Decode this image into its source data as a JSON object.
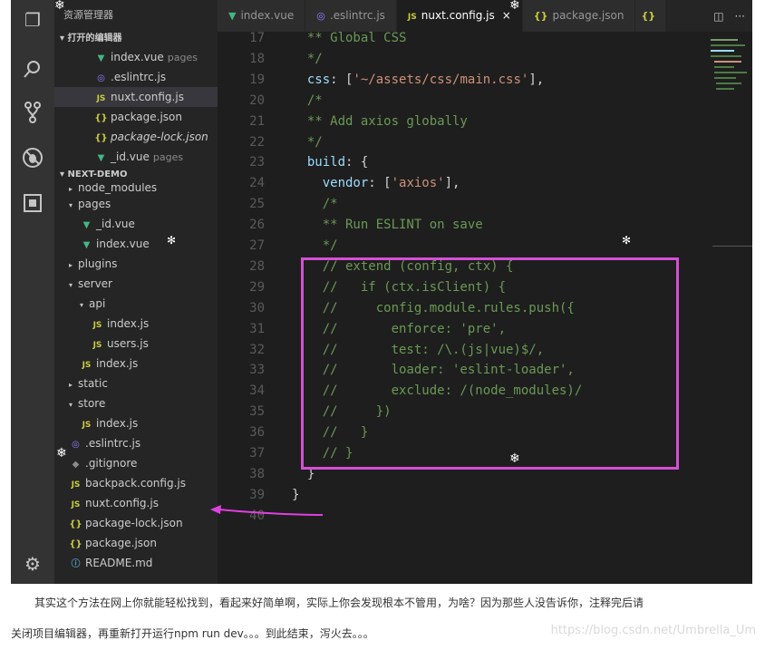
{
  "sidebar": {
    "title": "资源管理器",
    "open_editors_header": "打开的编辑器",
    "open_editors": [
      {
        "name": "index.vue",
        "hint": "pages",
        "icon": "vue-icon"
      },
      {
        "name": ".eslintrc.js",
        "hint": "",
        "icon": "eslint-icon"
      },
      {
        "name": "nuxt.config.js",
        "hint": "",
        "icon": "js-icon"
      },
      {
        "name": "package.json",
        "hint": "",
        "icon": "json-icon"
      },
      {
        "name": "package-lock.json",
        "hint": "",
        "icon": "json-icon"
      },
      {
        "name": "_id.vue",
        "hint": "pages",
        "icon": "vue-icon"
      }
    ],
    "project_header": "NEXT-DEMO",
    "tree": [
      {
        "name": "node_modules"
      },
      {
        "name": "pages"
      },
      {
        "name": "_id.vue"
      },
      {
        "name": "index.vue"
      },
      {
        "name": "plugins"
      },
      {
        "name": "server"
      },
      {
        "name": "api"
      },
      {
        "name": "index.js"
      },
      {
        "name": "users.js"
      },
      {
        "name": "index.js"
      },
      {
        "name": "static"
      },
      {
        "name": "store"
      },
      {
        "name": "index.js"
      },
      {
        "name": ".eslintrc.js"
      },
      {
        "name": ".gitignore"
      },
      {
        "name": "backpack.config.js"
      },
      {
        "name": "nuxt.config.js"
      },
      {
        "name": "package-lock.json"
      },
      {
        "name": "package.json"
      },
      {
        "name": "README.md"
      }
    ]
  },
  "tabs": [
    {
      "label": "index.vue",
      "icon": "vue-icon"
    },
    {
      "label": ".eslintrc.js",
      "icon": "eslint-icon"
    },
    {
      "label": "nuxt.config.js",
      "icon": "js-icon",
      "active": true
    },
    {
      "label": "package.json",
      "icon": "json-icon"
    },
    {
      "label": "{} ",
      "icon": "json-icon"
    }
  ],
  "tab_icons": {
    "vue": "V",
    "js": "JS",
    "json": "{}",
    "eslint": "◎",
    "close": "×",
    "split": "◫",
    "more": "···"
  },
  "editor": {
    "lines": [
      {
        "n": "17",
        "text": "  ** Global CSS"
      },
      {
        "n": "18",
        "text": "  */"
      },
      {
        "n": "19",
        "key": "  css",
        "rest": ": [",
        "str": "'~/assets/css/main.css'",
        "end": "],"
      },
      {
        "n": "20",
        "text": "  /*"
      },
      {
        "n": "21",
        "text": "  ** Add axios globally"
      },
      {
        "n": "22",
        "text": "  */"
      },
      {
        "n": "23",
        "key": "  build",
        "rest": ": {",
        "str": "",
        "end": ""
      },
      {
        "n": "24",
        "key": "    vendor",
        "rest": ": [",
        "str": "'axios'",
        "end": "],"
      },
      {
        "n": "25",
        "text": "    /*"
      },
      {
        "n": "26",
        "text": "    ** Run ESLINT on save"
      },
      {
        "n": "27",
        "text": "    */"
      },
      {
        "n": "28",
        "text": "    // extend (config, ctx) {"
      },
      {
        "n": "29",
        "text": "    //   if (ctx.isClient) {"
      },
      {
        "n": "30",
        "text": "    //     config.module.rules.push({"
      },
      {
        "n": "31",
        "text": "    //       enforce: 'pre',"
      },
      {
        "n": "32",
        "text": "    //       test: /\\.(js|vue)$/,"
      },
      {
        "n": "33",
        "text": "    //       loader: 'eslint-loader',"
      },
      {
        "n": "34",
        "text": "    //       exclude: /(node_modules)/"
      },
      {
        "n": "35",
        "text": "    //     })"
      },
      {
        "n": "36",
        "text": "    //   }"
      },
      {
        "n": "37",
        "text": "    // }"
      },
      {
        "n": "38",
        "punct": "  }"
      },
      {
        "n": "39",
        "punct": "}"
      },
      {
        "n": "40",
        "punct": ""
      }
    ]
  },
  "caption": {
    "line1": "其实这个方法在网上你就能轻松找到，看起来好简单啊，实际上你会发现根本不管用，为啥？因为那些人没告诉你，注释完后请",
    "line2": "关闭项目编辑器，再重新打开运行npm run dev。。。到此结束，泻火去。。。",
    "watermark": "https://blog.csdn.net/Umbrella_Um"
  },
  "colors": {
    "highlight": "#d64fd6",
    "arrow": "#e040e0"
  }
}
